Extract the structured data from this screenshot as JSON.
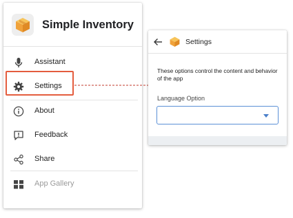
{
  "drawer": {
    "app_title": "Simple Inventory",
    "items": [
      {
        "label": "Assistant",
        "icon": "microphone-icon"
      },
      {
        "label": "Settings",
        "icon": "gear-icon"
      },
      {
        "label": "About",
        "icon": "info-icon"
      },
      {
        "label": "Feedback",
        "icon": "feedback-icon"
      },
      {
        "label": "Share",
        "icon": "share-icon"
      },
      {
        "label": "App Gallery",
        "icon": "app-gallery-icon"
      }
    ]
  },
  "settings_panel": {
    "title": "Settings",
    "description": "These options control the content and behavior of the app",
    "language_label": "Language Option",
    "language_value": ""
  },
  "colors": {
    "highlight": "#e45c3d",
    "connector": "#c0392b",
    "select_border": "#5a8fd6",
    "logo_box": "#f4a93b"
  }
}
